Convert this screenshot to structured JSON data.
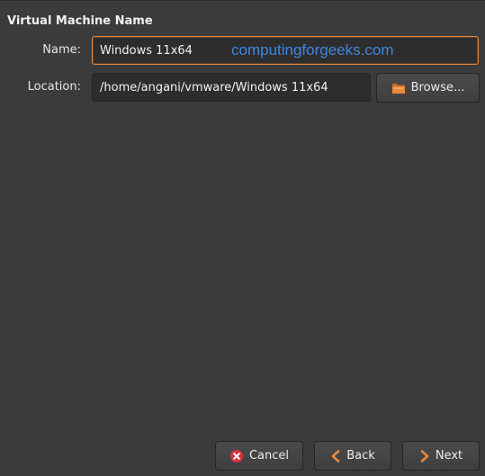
{
  "section": {
    "title": "Virtual Machine Name"
  },
  "name_field": {
    "label": "Name:",
    "value": "Windows 11x64"
  },
  "location_field": {
    "label": "Location:",
    "value": "/home/angani/vmware/Windows 11x64"
  },
  "watermark": "computingforgeeks.com",
  "buttons": {
    "browse": "Browse...",
    "cancel": "Cancel",
    "back": "Back",
    "next": "Next"
  },
  "colors": {
    "background": "#3b3b3b",
    "focus_border": "#e9873a",
    "watermark": "#3f86e0",
    "cancel_icon": "#d9333f",
    "nav_arrow": "#e9873a",
    "folder_icon": "#e9873a"
  },
  "icons": {
    "browse": "folder-icon",
    "cancel": "cancel-circle-icon",
    "back": "chevron-left-icon",
    "next": "chevron-right-icon"
  }
}
